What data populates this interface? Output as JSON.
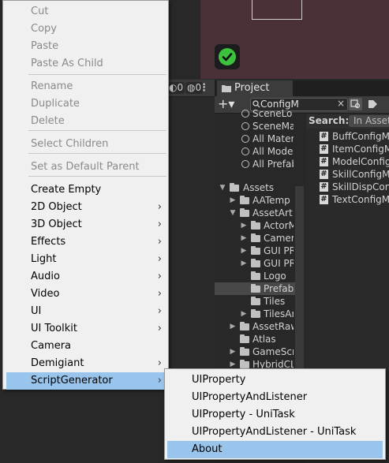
{
  "context_menu": {
    "items": [
      {
        "label": "Cut",
        "enabled": false
      },
      {
        "label": "Copy",
        "enabled": false
      },
      {
        "label": "Paste",
        "enabled": false
      },
      {
        "label": "Paste As Child",
        "enabled": false
      },
      {
        "label": "Rename",
        "enabled": false
      },
      {
        "label": "Duplicate",
        "enabled": false
      },
      {
        "label": "Delete",
        "enabled": false
      },
      {
        "label": "Select Children",
        "enabled": false
      },
      {
        "label": "Set as Default Parent",
        "enabled": false
      },
      {
        "label": "Create Empty",
        "enabled": true
      },
      {
        "label": "2D Object",
        "enabled": true,
        "submenu": true
      },
      {
        "label": "3D Object",
        "enabled": true,
        "submenu": true
      },
      {
        "label": "Effects",
        "enabled": true,
        "submenu": true
      },
      {
        "label": "Light",
        "enabled": true,
        "submenu": true
      },
      {
        "label": "Audio",
        "enabled": true,
        "submenu": true
      },
      {
        "label": "Video",
        "enabled": true,
        "submenu": true
      },
      {
        "label": "UI",
        "enabled": true,
        "submenu": true
      },
      {
        "label": "UI Toolkit",
        "enabled": true,
        "submenu": true
      },
      {
        "label": "Camera",
        "enabled": true
      },
      {
        "label": "Demigiant",
        "enabled": true,
        "submenu": true
      },
      {
        "label": "ScriptGenerator",
        "enabled": true,
        "submenu": true,
        "highlighted": true
      }
    ],
    "submenu_arrow": "›"
  },
  "submenu": {
    "items": [
      {
        "label": "UIProperty"
      },
      {
        "label": "UIPropertyAndListener"
      },
      {
        "label": "UIProperty - UniTask"
      },
      {
        "label": "UIPropertyAndListener - UniTask"
      },
      {
        "label": "About",
        "highlighted": true
      }
    ]
  },
  "hierarchy_toolbar": {
    "visibility_count": "0",
    "pick_count": "0",
    "menu_glyph": "⋮"
  },
  "project": {
    "tab_label": "Project",
    "add_label": "+▾",
    "search_value": "ConfigM",
    "search_clear": "×",
    "search_results_label": "Search:",
    "search_scope": "In Assets",
    "tree": [
      {
        "label": "SceneLo",
        "kind": "search"
      },
      {
        "label": "SceneMa",
        "kind": "search"
      },
      {
        "label": "All Materi",
        "kind": "search"
      },
      {
        "label": "All Model",
        "kind": "search"
      },
      {
        "label": "All Prefab",
        "kind": "search"
      },
      {
        "label": "Assets",
        "kind": "folder"
      },
      {
        "label": "AATemp",
        "kind": "folder"
      },
      {
        "label": "AssetArt",
        "kind": "folder"
      },
      {
        "label": "ActorM",
        "kind": "folder"
      },
      {
        "label": "Camer",
        "kind": "folder"
      },
      {
        "label": "GUI PR",
        "kind": "folder"
      },
      {
        "label": "GUI PR",
        "kind": "folder"
      },
      {
        "label": "Logo",
        "kind": "folder"
      },
      {
        "label": "Prefab",
        "kind": "folder",
        "selected": true
      },
      {
        "label": "Tiles",
        "kind": "folder"
      },
      {
        "label": "TilesAr",
        "kind": "folder"
      },
      {
        "label": "AssetRaw",
        "kind": "folder"
      },
      {
        "label": "Atlas",
        "kind": "folder"
      },
      {
        "label": "GameScr",
        "kind": "folder"
      },
      {
        "label": "HybridCL",
        "kind": "folder"
      }
    ],
    "results": [
      "BuffConfigMa",
      "ItemConfigMa",
      "ModelConfigM",
      "SkillConfigMa",
      "SkillDispConf",
      "TextConfigMa"
    ]
  },
  "colors": {
    "menu_bg": "#f0f0f0",
    "menu_highlight": "#99c4ec",
    "scene_bg": "#4a3138",
    "editor_bg": "#282828",
    "check_green": "#3cc23c"
  },
  "icons": [
    "check-icon",
    "folder-icon",
    "search-icon",
    "script-icon",
    "lock-icon",
    "eye-icon",
    "hand-icon",
    "chevron-right-icon",
    "chevron-down-icon",
    "kebab-icon"
  ]
}
